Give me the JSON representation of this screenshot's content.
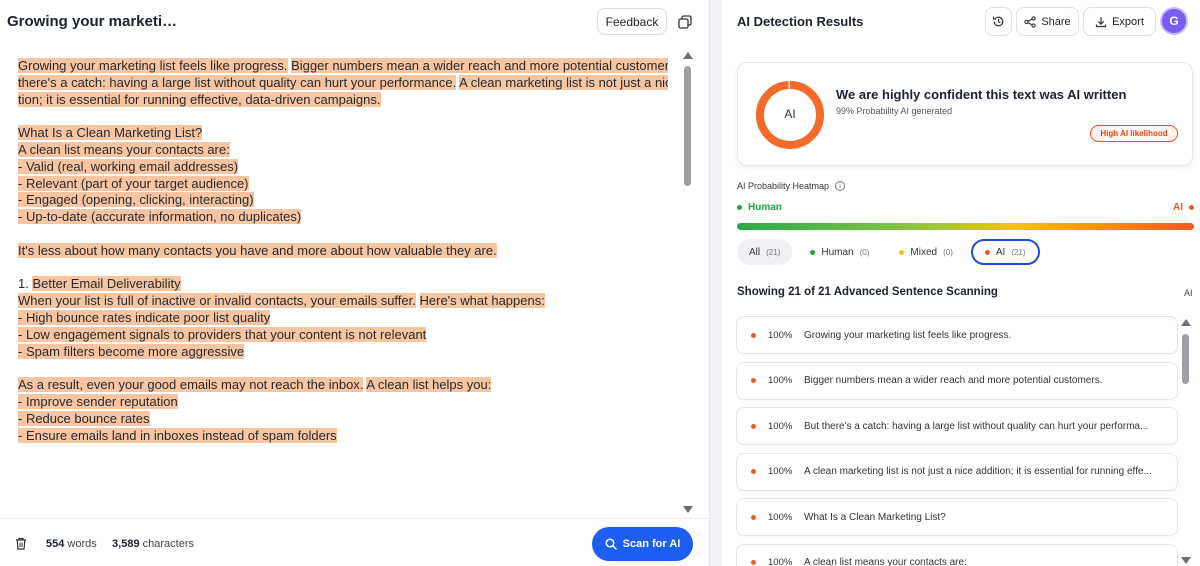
{
  "document": {
    "title": "Growing your marketi…",
    "feedback_label": "Feedback",
    "paragraphs": [
      {
        "lines": [
          [
            {
              "t": "Growing your marketing list feels like progress.",
              "h": true
            },
            {
              "t": " ",
              "h": false
            },
            {
              "t": "Bigger numbers mean a wider reach and more potential customers.",
              "h": true
            },
            {
              "t": " ",
              "h": false
            },
            {
              "t": "But",
              "h": true
            }
          ],
          [
            {
              "t": "there's a catch: having a large list without quality can hurt your performance.",
              "h": true
            },
            {
              "t": " ",
              "h": false
            },
            {
              "t": "A clean marketing list is not just a nice addi-",
              "h": true
            }
          ],
          [
            {
              "t": "tion; it is essential for running effective, data-driven campaigns.",
              "h": true
            }
          ]
        ]
      },
      {
        "blank": true
      },
      {
        "lines": [
          [
            {
              "t": "What Is a Clean Marketing List?",
              "h": true
            }
          ],
          [
            {
              "t": "A clean list means your contacts are: ",
              "h": true
            }
          ],
          [
            {
              "t": "- Valid (real, working email addresses) ",
              "h": true
            }
          ],
          [
            {
              "t": "- Relevant (part of your target audience) ",
              "h": true
            }
          ],
          [
            {
              "t": "- Engaged (opening, clicking, interacting) ",
              "h": true
            }
          ],
          [
            {
              "t": "- Up-to-date (accurate information, no duplicates) ",
              "h": true
            }
          ]
        ]
      },
      {
        "blank": true
      },
      {
        "lines": [
          [
            {
              "t": "It's less about how many contacts you have and more about how valuable they are.",
              "h": true
            }
          ]
        ]
      },
      {
        "blank": true
      },
      {
        "lines": [
          [
            {
              "t": "1. ",
              "h": false
            },
            {
              "t": "Better Email Deliverability ",
              "h": true
            }
          ],
          [
            {
              "t": "When your list is full of inactive or invalid contacts, your emails suffer.",
              "h": true
            },
            {
              "t": " ",
              "h": false
            },
            {
              "t": "Here's what happens: ",
              "h": true
            }
          ],
          [
            {
              "t": "- High bounce rates indicate poor list quality ",
              "h": true
            }
          ],
          [
            {
              "t": "- Low engagement signals to providers that your content is not relevant ",
              "h": true
            }
          ],
          [
            {
              "t": "- Spam filters become more aggressive ",
              "h": true
            }
          ]
        ]
      },
      {
        "blank": true
      },
      {
        "lines": [
          [
            {
              "t": "As a result, even your good emails may not reach the inbox.",
              "h": true
            },
            {
              "t": " ",
              "h": false
            },
            {
              "t": "A clean list helps you: ",
              "h": true
            }
          ],
          [
            {
              "t": "- Improve sender reputation ",
              "h": true
            }
          ],
          [
            {
              "t": "- Reduce bounce rates ",
              "h": true
            }
          ],
          [
            {
              "t": "- Ensure emails land in inboxes instead of spam folders ",
              "h": true
            }
          ]
        ]
      }
    ],
    "word_count": "554",
    "word_unit": "words",
    "char_count": "3,589",
    "char_unit": "characters",
    "scan_label": "Scan for AI"
  },
  "results": {
    "title": "AI Detection Results",
    "share_label": "Share",
    "export_label": "Export",
    "avatar_initial": "G",
    "donut_label": "AI",
    "ai_fraction": 0.99,
    "verdict": "We are highly confident this text was AI written",
    "probability_text": "99% Probability AI generated",
    "badge": "High AI likelihood",
    "heatmap_label": "AI Probability Heatmap",
    "legend_human": "Human",
    "legend_ai": "AI",
    "filters": [
      {
        "label": "All",
        "count": "(21)"
      },
      {
        "label": "Human",
        "count": "(0)"
      },
      {
        "label": "Mixed",
        "count": "(0)"
      },
      {
        "label": "AI",
        "count": "(21)"
      }
    ],
    "showing": "Showing 21 of 21 Advanced Sentence Scanning",
    "showing_right": "AI",
    "sentences": [
      {
        "pct": "100%",
        "text": "Growing your marketing list feels like progress."
      },
      {
        "pct": "100%",
        "text": "Bigger numbers mean a wider reach and more potential customers."
      },
      {
        "pct": "100%",
        "text": "But there's a catch: having a large list without quality can hurt your performa..."
      },
      {
        "pct": "100%",
        "text": "A clean marketing list is not just a nice addition; it is essential for running effe..."
      },
      {
        "pct": "100%",
        "text": "What Is a Clean Marketing List?"
      },
      {
        "pct": "100%",
        "text": "A clean list means your contacts are:"
      }
    ],
    "colors": {
      "ai": "#ee5a24",
      "human": "#22a43a",
      "mixed": "#f2c21b",
      "accent": "#1d5ef0"
    }
  }
}
